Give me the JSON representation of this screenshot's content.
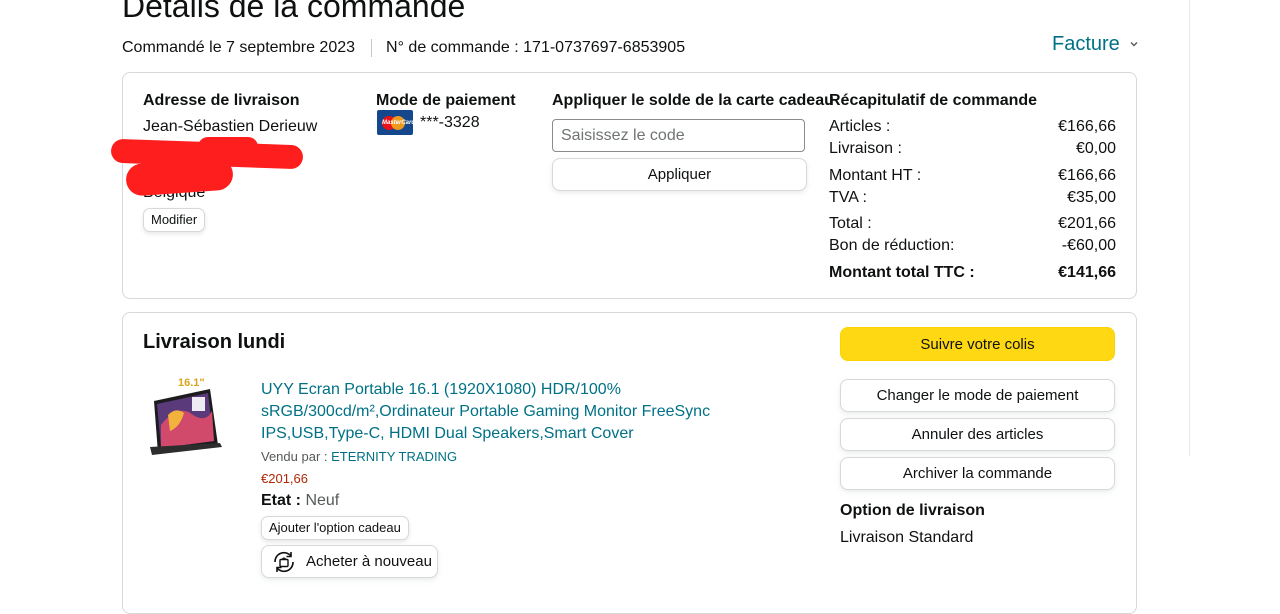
{
  "page": {
    "title": "Détails de la commande",
    "ordered_on": "Commandé le 7 septembre 2023",
    "order_number": "N° de commande : 171-0737697-6853905",
    "invoice_label": "Facture"
  },
  "shipping": {
    "title": "Adresse de livraison",
    "name": "Jean-Sébastien Derieuw",
    "country": "Belgique",
    "edit_label": "Modifier"
  },
  "payment": {
    "title": "Mode de paiement",
    "card_last4": "***-3328",
    "card_icon": "mastercard-icon"
  },
  "gift_card": {
    "title": "Appliquer le solde de la carte cadeau",
    "placeholder": "Saisissez le code",
    "apply_label": "Appliquer"
  },
  "summary": {
    "title": "Récapitulatif de commande",
    "rows": [
      {
        "label": "Articles :",
        "value": "€166,66"
      },
      {
        "label": "Livraison :",
        "value": "€0,00"
      },
      {
        "label": "Montant HT :",
        "value": "€166,66"
      },
      {
        "label": "TVA :",
        "value": "€35,00"
      },
      {
        "label": "Total :",
        "value": "€201,66"
      },
      {
        "label": "Bon de réduction:",
        "value": "-€60,00"
      }
    ],
    "grand_total_label": "Montant total TTC :",
    "grand_total_value": "€141,66"
  },
  "delivery": {
    "title": "Livraison lundi",
    "product": {
      "title": "UYY Ecran Portable 16.1 (1920X1080) HDR/100% sRGB/300cd/m²,Ordinateur Portable Gaming Monitor FreeSync IPS,USB,Type-C, HDMI Dual Speakers,Smart Cover",
      "sold_by_label": "Vendu par :",
      "seller": "ETERNITY TRADING",
      "price": "€201,66",
      "condition_label": "Etat :",
      "condition_value": "Neuf",
      "gift_option_label": "Ajouter l'option cadeau",
      "buy_again_label": "Acheter à nouveau",
      "image_badge": "16.1\""
    },
    "actions": {
      "track": "Suivre votre colis",
      "change_payment": "Changer le mode de paiement",
      "cancel_items": "Annuler des articles",
      "archive": "Archiver la commande"
    },
    "shipping_option_title": "Option de livraison",
    "shipping_option_value": "Livraison Standard"
  },
  "colors": {
    "link": "#007185",
    "price": "#b12704",
    "primary_button": "#ffd814",
    "redaction": "#ff1e1e"
  }
}
